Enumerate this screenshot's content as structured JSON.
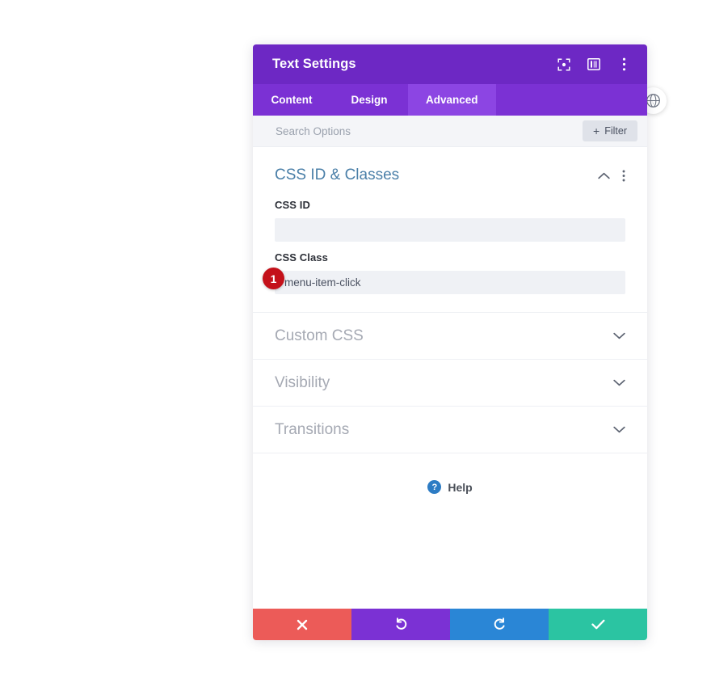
{
  "globe_button": {
    "icon": "globe-icon"
  },
  "header": {
    "title": "Text Settings",
    "icons": [
      {
        "name": "focus-target-icon"
      },
      {
        "name": "layout-panel-icon"
      },
      {
        "name": "more-vertical-icon"
      }
    ]
  },
  "tabs": [
    {
      "label": "Content",
      "active": false
    },
    {
      "label": "Design",
      "active": false
    },
    {
      "label": "Advanced",
      "active": true
    }
  ],
  "search": {
    "placeholder": "Search Options",
    "value": "",
    "filter_label": "Filter",
    "filter_plus": "+"
  },
  "sections": {
    "css_id_classes": {
      "title": "CSS ID & Classes",
      "expanded": true,
      "collapse_icon": "chevron-up-icon",
      "menu_icon": "more-vertical-icon",
      "fields": [
        {
          "label": "CSS ID",
          "value": "",
          "badge": null
        },
        {
          "label": "CSS Class",
          "value": "menu-item-click",
          "badge": "1"
        }
      ]
    },
    "collapsed": [
      {
        "title": "Custom CSS",
        "chevron": "chevron-down-icon"
      },
      {
        "title": "Visibility",
        "chevron": "chevron-down-icon"
      },
      {
        "title": "Transitions",
        "chevron": "chevron-down-icon"
      }
    ]
  },
  "help": {
    "icon_glyph": "?",
    "label": "Help"
  },
  "footer": {
    "buttons": [
      {
        "name": "cancel-button",
        "icon": "close-x-icon",
        "color": "#ec5b58"
      },
      {
        "name": "undo-button",
        "icon": "undo-arrow-icon",
        "color": "#7b31d4"
      },
      {
        "name": "redo-button",
        "icon": "redo-arrow-icon",
        "color": "#2a86d6"
      },
      {
        "name": "save-button",
        "icon": "checkmark-icon",
        "color": "#2bc4a2"
      }
    ]
  },
  "colors": {
    "header_purple": "#6d28c4",
    "tabbar_purple": "#7b31d4",
    "tab_active_purple": "#8c45e3",
    "section_title_blue": "#4a7fa8",
    "badge_red": "#c4111a",
    "help_blue": "#2d7cc4"
  }
}
